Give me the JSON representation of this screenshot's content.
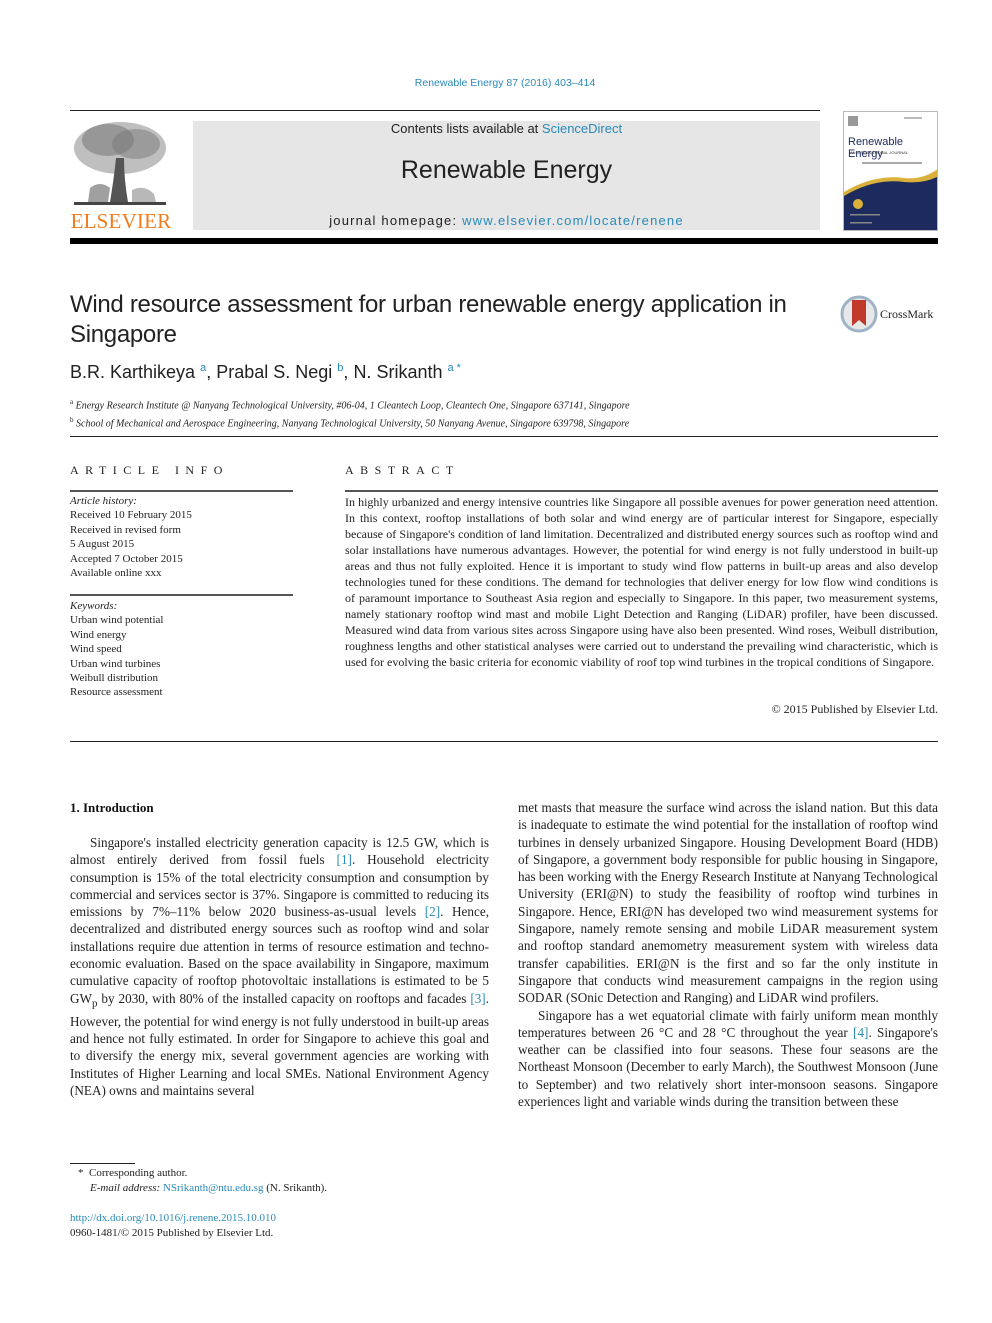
{
  "header": {
    "citation": "Renewable Energy 87 (2016) 403–414",
    "contents_prefix": "Contents lists available at ",
    "contents_link": "ScienceDirect",
    "journal_name": "Renewable Energy",
    "homepage_prefix": "journal homepage: ",
    "homepage_link": "www.elsevier.com/locate/renene",
    "publisher_logo_text": "ELSEVIER",
    "cover_title": "Renewable Energy",
    "cover_subtitle": "AN INTERNATIONAL JOURNAL",
    "crossmark_label": "CrossMark"
  },
  "article": {
    "title": "Wind resource assessment for urban renewable energy application in Singapore",
    "authors": [
      {
        "name": "B.R. Karthikeya",
        "affil": "a"
      },
      {
        "name": "Prabal S. Negi",
        "affil": "b"
      },
      {
        "name": "N. Srikanth",
        "affil": "a *"
      }
    ],
    "affiliations": [
      {
        "key": "a",
        "text": "Energy Research Institute @ Nanyang Technological University, #06-04, 1 Cleantech Loop, Cleantech One, Singapore 637141, Singapore"
      },
      {
        "key": "b",
        "text": "School of Mechanical and Aerospace Engineering, Nanyang Technological University, 50 Nanyang Avenue, Singapore 639798, Singapore"
      }
    ]
  },
  "article_info": {
    "heading": "ARTICLE INFO",
    "history_label": "Article history:",
    "history": [
      "Received 10 February 2015",
      "Received in revised form",
      "5 August 2015",
      "Accepted 7 October 2015",
      "Available online xxx"
    ],
    "keywords_label": "Keywords:",
    "keywords": [
      "Urban wind potential",
      "Wind energy",
      "Wind speed",
      "Urban wind turbines",
      "Weibull distribution",
      "Resource assessment"
    ]
  },
  "abstract": {
    "heading": "ABSTRACT",
    "text": "In highly urbanized and energy intensive countries like Singapore all possible avenues for power generation need attention. In this context, rooftop installations of both solar and wind energy are of particular interest for Singapore, especially because of Singapore's condition of land limitation. Decentralized and distributed energy sources such as rooftop wind and solar installations have numerous advantages. However, the potential for wind energy is not fully understood in built-up areas and thus not fully exploited. Hence it is important to study wind flow patterns in built-up areas and also develop technologies tuned for these conditions. The demand for technologies that deliver energy for low flow wind conditions is of paramount importance to Southeast Asia region and especially to Singapore. In this paper, two measurement systems, namely stationary rooftop wind mast and mobile Light Detection and Ranging (LiDAR) profiler, have been discussed. Measured wind data from various sites across Singapore using have also been presented. Wind roses, Weibull distribution, roughness lengths and other statistical analyses were carried out to understand the prevailing wind characteristic, which is used for evolving the basic criteria for economic viability of roof top wind turbines in the tropical conditions of Singapore.",
    "copyright": "© 2015 Published by Elsevier Ltd."
  },
  "body": {
    "intro_heading": "1.  Introduction",
    "left": {
      "p1_a": "Singapore's installed electricity generation capacity is 12.5 GW, which is almost entirely derived from fossil fuels ",
      "ref1": "[1]",
      "p1_b": ". Household electricity consumption is 15% of the total electricity consumption and consumption by commercial and services sector is 37%. Singapore is committed to reducing its emissions by 7%–11% below 2020 business-as-usual levels ",
      "ref2": "[2]",
      "p1_c": ". Hence, decentralized and distributed energy sources such as rooftop wind and solar installations require due attention in terms of resource estimation and techno-economic evaluation. Based on the space availability in Singapore, maximum cumulative capacity of rooftop photovoltaic installations is estimated to be 5 GW",
      "gw_sub": "p",
      "p1_d": " by 2030, with 80% of the installed capacity on rooftops and facades ",
      "ref3": "[3]",
      "p1_e": ". However, the potential for wind energy is not fully understood in built-up areas and hence not fully estimated. In order for Singapore to achieve this goal and to diversify the energy mix, several government agencies are working with Institutes of Higher Learning and local SMEs. National Environment Agency (NEA) owns and maintains several"
    },
    "right": {
      "p1": "met masts that measure the surface wind across the island nation. But this data is inadequate to estimate the wind potential for the installation of rooftop wind turbines in densely urbanized Singapore. Housing Development Board (HDB) of Singapore, a government body responsible for public housing in Singapore, has been working with the Energy Research Institute at Nanyang Technological University (ERI@N) to study the feasibility of rooftop wind turbines in Singapore. Hence, ERI@N has developed two wind measurement systems for Singapore, namely remote sensing and mobile LiDAR measurement system and rooftop standard anemometry measurement system with wireless data transfer capabilities. ERI@N is the first and so far the only institute in Singapore that conducts wind measurement campaigns in the region using SODAR (SOnic Detection and Ranging) and LiDAR wind profilers.",
      "p2_a": "Singapore has a wet equatorial climate with fairly uniform mean monthly temperatures between 26 °C and 28 °C throughout the year ",
      "ref4": "[4]",
      "p2_b": ". Singapore's weather can be classified into four seasons. These four seasons are the Northeast Monsoon (December to early March), the Southwest Monsoon (June to September) and two relatively short inter-monsoon seasons. Singapore experiences light and variable winds during the transition between these"
    }
  },
  "footnote": {
    "marker": "*",
    "corresponding": "Corresponding author.",
    "email_label": "E-mail address: ",
    "email": "NSrikanth@ntu.edu.sg",
    "email_suffix": " (N. Srikanth)."
  },
  "doi": {
    "link": "http://dx.doi.org/10.1016/j.renene.2015.10.010",
    "issn_line": "0960-1481/© 2015 Published by Elsevier Ltd."
  },
  "colors": {
    "link": "#2a8ab8",
    "elsevier_orange": "#f07c1e",
    "banner_gray": "#e6e6e6",
    "cover_navy": "#1d2a5e",
    "cover_gold": "#d9b13a",
    "crossmark_red": "#c0392b"
  }
}
